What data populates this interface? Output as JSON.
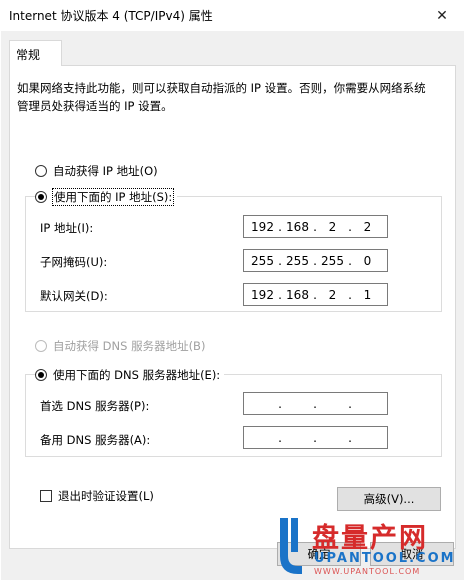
{
  "window": {
    "title": "Internet 协议版本 4 (TCP/IPv4) 属性",
    "close_glyph": "✕"
  },
  "tabs": [
    {
      "label": "常规"
    }
  ],
  "description": "如果网络支持此功能，则可以获取自动指派的 IP 设置。否则，你需要从网络系统管理员处获得适当的 IP 设置。",
  "ip_section": {
    "auto_label": "自动获得 IP 地址(O)",
    "auto_selected": false,
    "manual_label": "使用下面的 IP 地址(S):",
    "manual_selected": true,
    "fields": [
      {
        "label": "IP 地址(I):",
        "octets": [
          "192",
          "168",
          "2",
          "2"
        ]
      },
      {
        "label": "子网掩码(U):",
        "octets": [
          "255",
          "255",
          "255",
          "0"
        ]
      },
      {
        "label": "默认网关(D):",
        "octets": [
          "192",
          "168",
          "2",
          "1"
        ]
      }
    ]
  },
  "dns_section": {
    "auto_label": "自动获得 DNS 服务器地址(B)",
    "auto_selected": false,
    "auto_disabled": true,
    "manual_label": "使用下面的 DNS 服务器地址(E):",
    "manual_selected": true,
    "fields": [
      {
        "label": "首选 DNS 服务器(P):",
        "octets": [
          "",
          "",
          "",
          ""
        ]
      },
      {
        "label": "备用 DNS 服务器(A):",
        "octets": [
          "",
          "",
          "",
          ""
        ]
      }
    ]
  },
  "validate_checkbox": {
    "label": "退出时验证设置(L)",
    "checked": false
  },
  "buttons": {
    "advanced": "高级(V)...",
    "ok": "确定",
    "cancel": "取消"
  },
  "watermark": {
    "brand": "盘量产网",
    "site": "UPANTOOL.COM",
    "url_text": "WWW.UPANTOOL.COM"
  },
  "colors": {
    "accent_blue": "#1a73c8",
    "watermark_red": "#d62b2b",
    "text_disabled": "#a0a0a0"
  }
}
